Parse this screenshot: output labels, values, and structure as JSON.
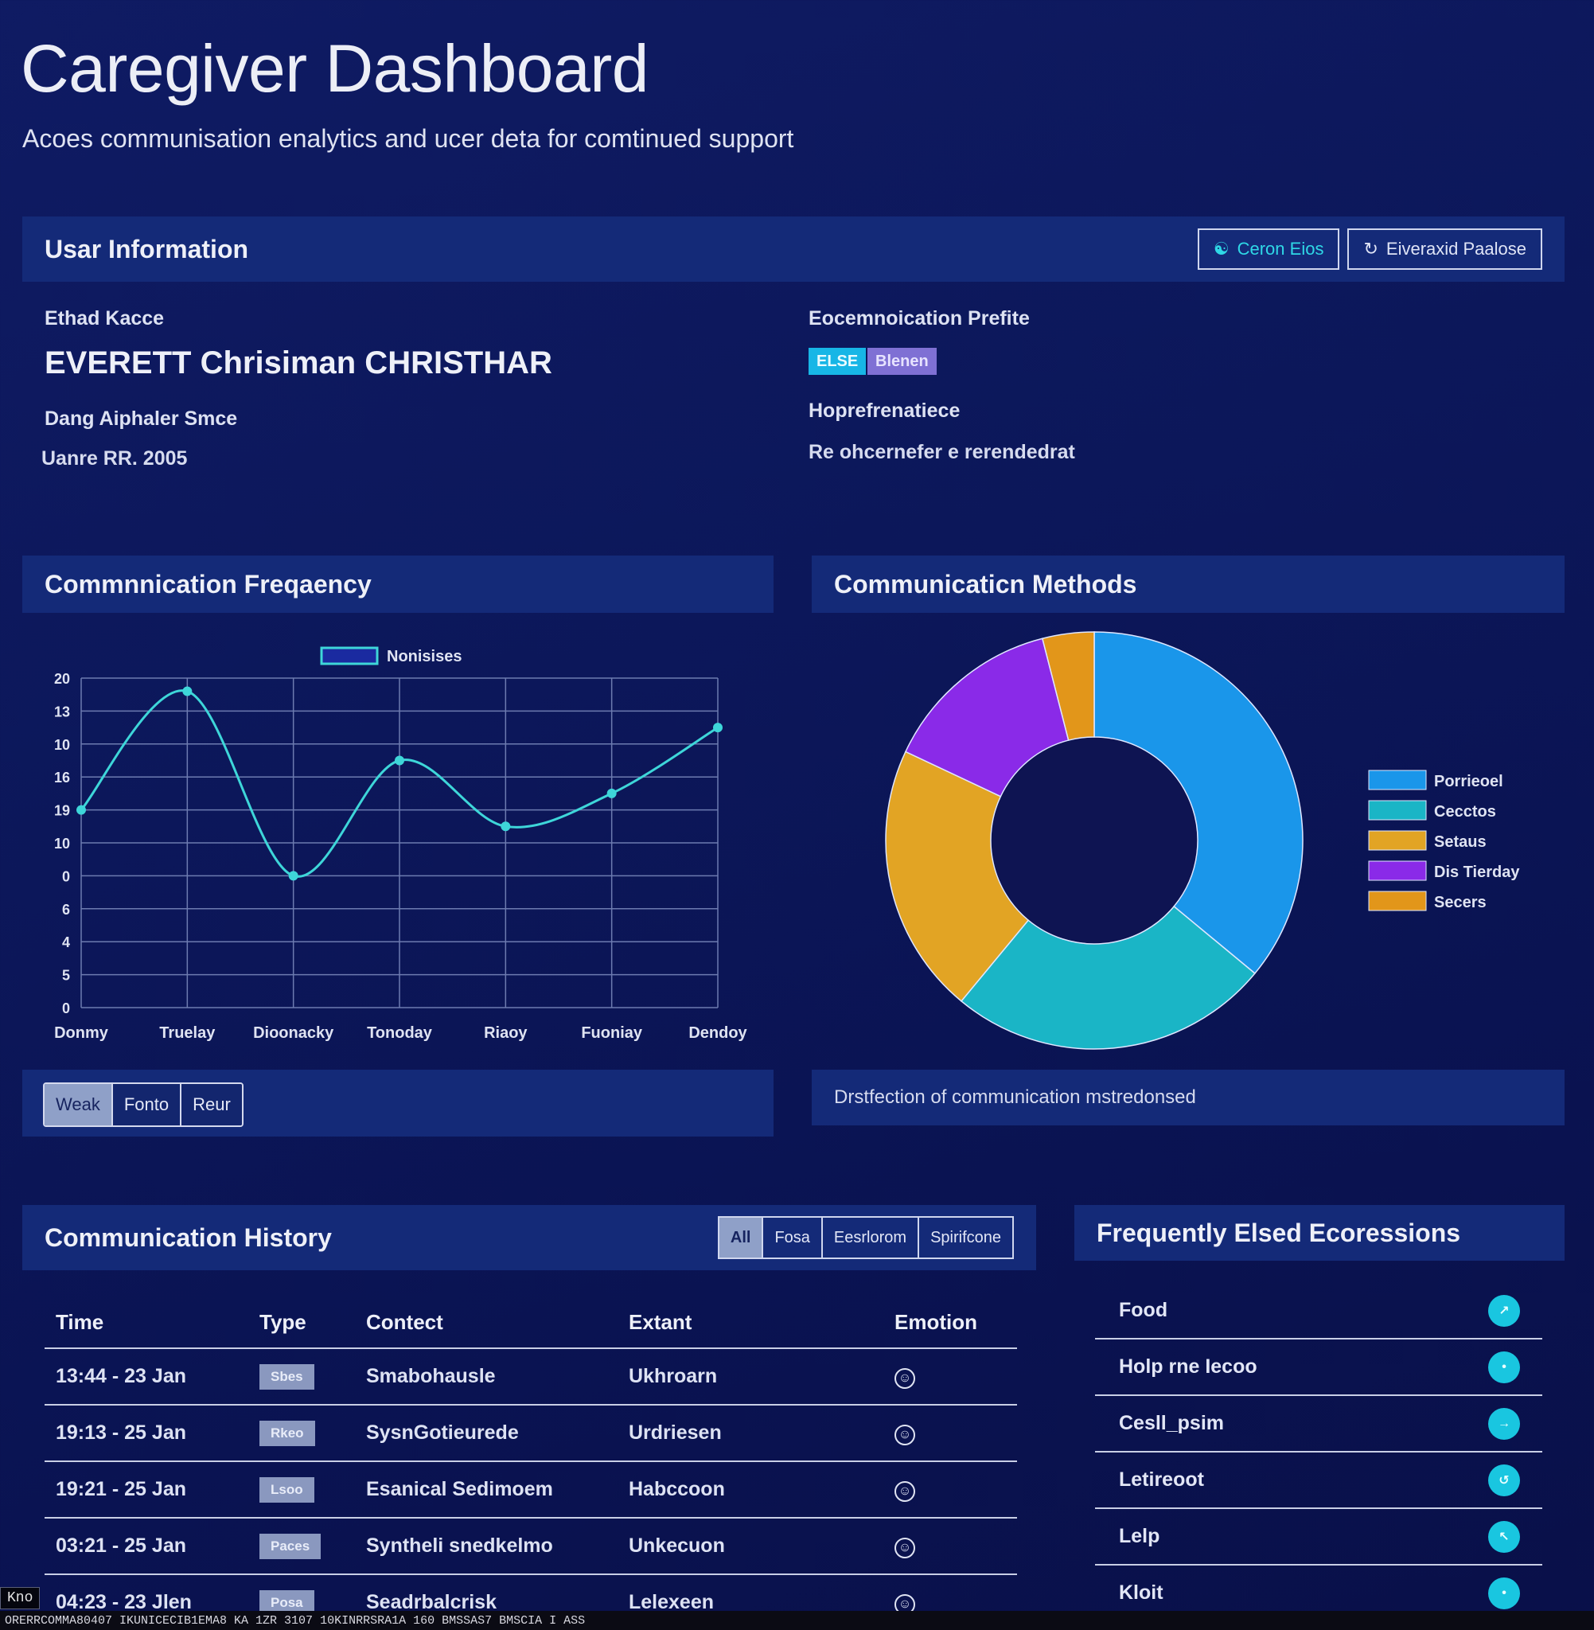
{
  "page": {
    "title": "Caregiver Dashboard",
    "subtitle": "Acoes communisation enalytics and ucer deta for comtinued support"
  },
  "user_info": {
    "title": "Usar Information",
    "actions": [
      {
        "label": "Ceron Eios",
        "icon": "users-icon"
      },
      {
        "label": "Eiveraxid Paalose",
        "icon": "refresh-icon"
      }
    ],
    "name_label": "Ethad Kacce",
    "name_value": "EVERETT Chrisiman CHRISTHAR",
    "since_label": "Dang Aiphaler Smce",
    "since_value": "Uanre RR. 2005",
    "profile_label": "Eocemnoication Prefite",
    "tags": [
      {
        "label": "ELSE",
        "color": "#17b6e6"
      },
      {
        "label": "Blenen",
        "color": "#7f70d4"
      }
    ],
    "pref_label": "Hoprefrenatiece",
    "pref_value": "Re ohcernefer e rerendedrat"
  },
  "comm_frequency": {
    "title": "Commnnication Freqaency",
    "range_options": [
      {
        "label": "Weak",
        "active": true
      },
      {
        "label": "Fonto",
        "active": false
      },
      {
        "label": "Reur",
        "active": false
      }
    ]
  },
  "comm_methods": {
    "title": "Communicaticn Methods",
    "footer": "Drstfection of communication mstredonsed"
  },
  "chart_data": [
    {
      "type": "line",
      "title": "",
      "legend": [
        "Nonisises"
      ],
      "legend_position": "top",
      "y_ticks": [
        "0",
        "5",
        "4",
        "6",
        "0",
        "10",
        "19",
        "16",
        "10",
        "13",
        "20"
      ],
      "x_ticks": [
        "Donmy",
        "Truelay",
        "Dioonacky",
        "Tonoday",
        "Riaoy",
        "Fuoniay",
        "Dendoy"
      ],
      "series": [
        {
          "name": "Nonisises",
          "color": "#3ed6d9",
          "values": [
            6,
            9.6,
            4,
            7.5,
            5.5,
            6.5,
            8.5
          ]
        }
      ],
      "ylim": [
        0,
        10
      ],
      "grid": true
    },
    {
      "type": "pie",
      "donut": true,
      "legend_position": "right",
      "labels": [
        "Porrieoel",
        "Cecctos",
        "Setaus",
        "Dis Tierday",
        "Secers"
      ],
      "values": [
        36,
        25,
        21,
        14,
        4
      ],
      "colors": [
        "#1a96ea",
        "#1ab5c6",
        "#e2a424",
        "#8a2ae8",
        "#e2961a"
      ]
    }
  ],
  "history": {
    "title": "Communication History",
    "filters": [
      {
        "label": "All",
        "active": true
      },
      {
        "label": "Fosa",
        "active": false
      },
      {
        "label": "Eesrlorom",
        "active": false
      },
      {
        "label": "Spirifcone",
        "active": false
      }
    ],
    "columns": [
      "Time",
      "Type",
      "Contect",
      "Extant",
      "Emotion"
    ],
    "rows": [
      {
        "time": "13:44 - 23 Jan",
        "type": "Sbes",
        "content": "Smabohausle",
        "extent": "Ukhroarn",
        "emotion": "☺"
      },
      {
        "time": "19:13 - 25 Jan",
        "type": "Rkeo",
        "content": "SysnGotieurede",
        "extent": "Urdriesen",
        "emotion": "☺"
      },
      {
        "time": "19:21 - 25 Jan",
        "type": "Lsoo",
        "content": "Esanical Sedimoem",
        "extent": "Habccoon",
        "emotion": "☺"
      },
      {
        "time": "03:21 - 25 Jan",
        "type": "Paces",
        "content": "Syntheli snedkelmo",
        "extent": "Unkecuon",
        "emotion": "☺"
      },
      {
        "time": "04:23 - 23 Jlen",
        "type": "Posa",
        "content": "Seadrbalcrisk",
        "extent": "Lelexeen",
        "emotion": "☺"
      }
    ]
  },
  "expressions": {
    "title": "Frequently Elsed Ecoressions",
    "items": [
      {
        "label": "Food",
        "icon": "arrow-icon"
      },
      {
        "label": "Holp rne Iecoo",
        "icon": "dot-icon"
      },
      {
        "label": "Cesll_psim",
        "icon": "arrow-icon"
      },
      {
        "label": "Letireoot",
        "icon": "arrow-icon"
      },
      {
        "label": "Lelp",
        "icon": "arrow-icon"
      },
      {
        "label": "Kloit",
        "icon": "arrow-icon"
      }
    ]
  },
  "statusbar": {
    "tag": "Kno",
    "text": "ORERRCOMMA80407 IKUNICECIB1EMA8 KA 1ZR 3107 10KINRRSRA1A 160 BMSSAS7 BMSCIA I ASS"
  },
  "colors": {
    "background": "#0c175a",
    "panel": "#142a78",
    "accent": "#2fd8e6"
  }
}
